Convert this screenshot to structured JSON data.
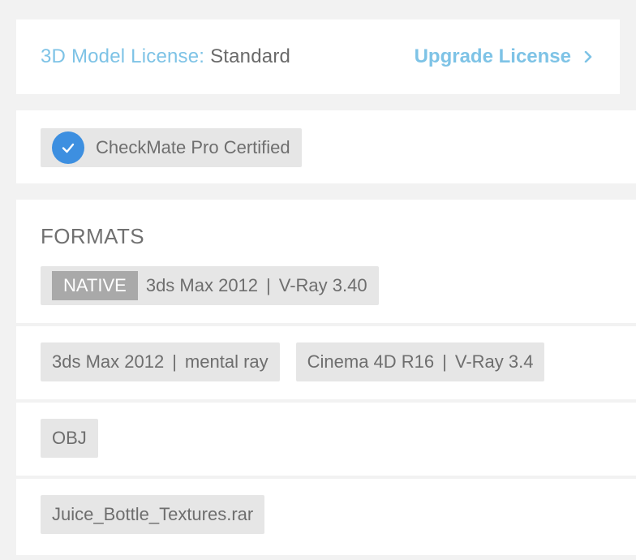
{
  "license": {
    "label": "3D Model License:",
    "value": "Standard",
    "upgrade_label": "Upgrade License"
  },
  "certification": {
    "label": "CheckMate Pro Certified"
  },
  "formats": {
    "title": "FORMATS",
    "native": {
      "badge": "NATIVE",
      "app": "3ds Max 2012",
      "separator": "|",
      "renderer": "V-Ray 3.40"
    },
    "other": [
      {
        "app": "3ds Max 2012",
        "separator": "|",
        "renderer": "mental ray"
      },
      {
        "app": "Cinema 4D R16",
        "separator": "|",
        "renderer": "V-Ray 3.4"
      }
    ],
    "obj": "OBJ",
    "textures": "Juice_Bottle_Textures.rar"
  },
  "colors": {
    "accent": "#7ec3e6",
    "check_blue": "#3d8fe0",
    "tag_bg": "#e6e6e6",
    "native_badge_bg": "#a9a9a9"
  },
  "icons": {
    "upgrade": "chevron-right-icon",
    "certified": "checkmark-icon"
  }
}
